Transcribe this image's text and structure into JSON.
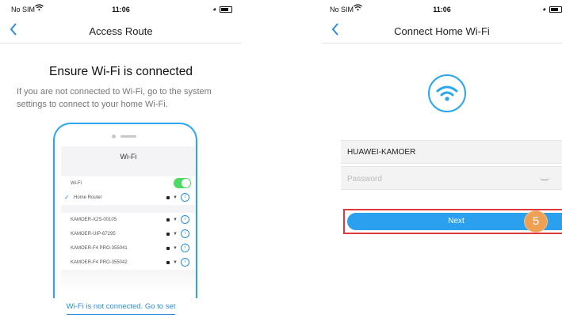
{
  "left": {
    "status": {
      "carrier": "No SIM",
      "time": "11:06"
    },
    "nav": {
      "title": "Access Route"
    },
    "heading": "Ensure Wi-Fi is connected",
    "description": "If you are not connected to Wi-Fi, go to the system settings to connect to your home Wi-Fi.",
    "phone": {
      "title": "Wi-Fi",
      "wifi_label": "Wi-Fi",
      "wifi_enabled": true,
      "connected_network": "Home Router",
      "networks": [
        "KAMOER-X2S-00105",
        "KAMOER-UIP-67295",
        "KAMOER-F4 PRO-355041",
        "KAMOER-F4 PRO-355042"
      ]
    },
    "link_text": "Wi-Fi is not connected. Go to set"
  },
  "right": {
    "status": {
      "carrier": "No SIM",
      "time": "11:06"
    },
    "nav": {
      "title": "Connect Home Wi-Fi"
    },
    "ssid": "HUAWEI-KAMOER",
    "password_placeholder": "Password",
    "next_label": "Next",
    "step_badge": "5"
  },
  "colors": {
    "accent": "#2aa0ee",
    "highlight": "#e0373a",
    "badge": "#eea053",
    "toggle_on": "#4cd964"
  },
  "icons": [
    "back-chevron-icon",
    "wifi-icon",
    "battery-icon",
    "info-icon",
    "lock-icon",
    "eye-hidden-icon",
    "check-icon"
  ]
}
